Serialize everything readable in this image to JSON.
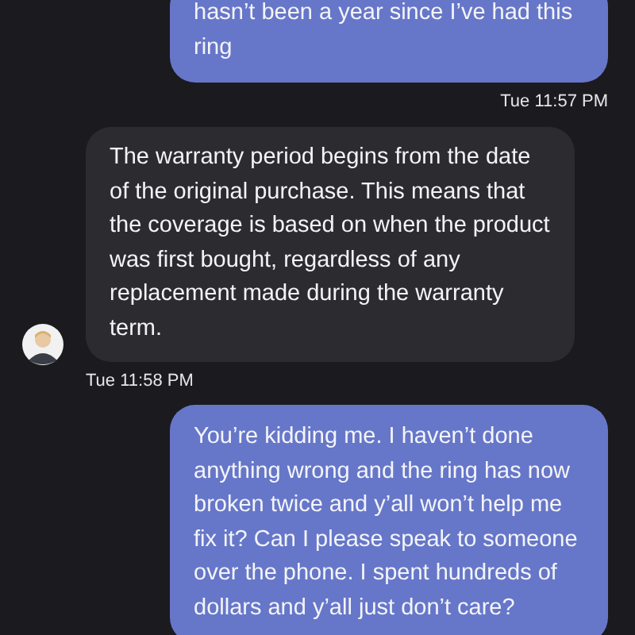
{
  "messages": [
    {
      "kind": "outgoing",
      "lines": [
        "hasn’t been a year since I’ve had this",
        "ring"
      ],
      "time": "Tue 11:57 PM"
    },
    {
      "kind": "incoming",
      "lines": [
        "The warranty period begins from the date",
        "of the original purchase. This means that",
        "the coverage is based on when the product",
        "was first bought, regardless of any",
        "replacement made during the warranty",
        "term."
      ],
      "time": "Tue 11:58 PM"
    },
    {
      "kind": "outgoing",
      "lines": [
        "You’re kidding me. I haven’t done",
        "anything wrong and the ring has now",
        "broken twice and y’all won’t help me",
        "fix it? Can I please speak to someone",
        "over the phone. I spent hundreds of",
        "dollars and y’all just don’t care?"
      ]
    }
  ]
}
